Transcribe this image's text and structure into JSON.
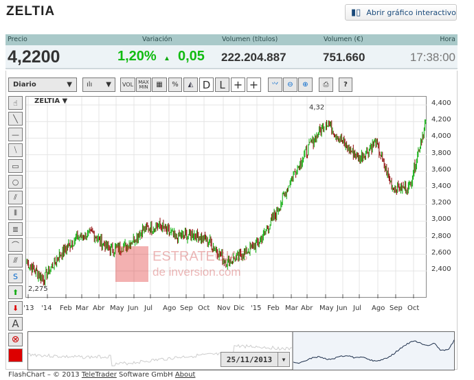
{
  "title": "ZELTIA",
  "open_button": "Abrir gráfico interactivo",
  "header": {
    "precio": "Precio",
    "variacion": "Variación",
    "vol_titulos": "Volumen (títulos)",
    "vol_eur": "Volumen (€)",
    "hora": "Hora"
  },
  "values": {
    "precio": "4,2200",
    "var_pct": "1,20%",
    "var_abs": "0,05",
    "vol_titulos": "222.204.887",
    "vol_eur": "751.660",
    "hora": "17:38:00"
  },
  "toolbar": {
    "period": "Diario",
    "vol": "VOL",
    "maxmin": "MAX MIN",
    "pct": "%",
    "d": "D",
    "l": "L",
    "help": "?"
  },
  "chart_label": "ZELTIA ▼",
  "colors": {
    "up": "#00aa00",
    "down": "#8b0000",
    "accent": "#11bb11"
  },
  "chart_data": {
    "type": "candlestick",
    "y_ticks": [
      "4,400",
      "4,200",
      "4,000",
      "3,800",
      "3,600",
      "3,400",
      "3,200",
      "3,000",
      "2,800",
      "2,600",
      "2,400"
    ],
    "ylim": [
      2.2,
      4.5
    ],
    "x_ticks": [
      "'13",
      "'14",
      "Feb",
      "Mar",
      "Abr",
      "May",
      "Jun",
      "Jul",
      "Ago",
      "Sep",
      "Oct",
      "Nov",
      "Dic",
      "'15",
      "Feb",
      "Mar",
      "Abr",
      "May",
      "Jun",
      "Jul",
      "Ago",
      "Sep",
      "Oct"
    ],
    "monthly_close_approx": [
      2.5,
      2.3,
      2.6,
      2.8,
      2.85,
      2.65,
      2.7,
      2.9,
      2.95,
      2.8,
      2.85,
      2.75,
      2.5,
      2.6,
      2.75,
      3.1,
      3.55,
      3.9,
      4.2,
      3.95,
      3.75,
      3.95,
      3.4,
      3.4,
      4.2
    ],
    "annotations": {
      "max": "4,32",
      "min": "2,275"
    }
  },
  "navigator": {
    "date": "25/11/2013"
  },
  "watermark": "ESTRATEGIAS de inversion.com",
  "footer": {
    "prefix": "FlashChart – © 2013",
    "teletrader": "TeleTrader",
    "middle": "Software GmbH",
    "about": "About"
  }
}
